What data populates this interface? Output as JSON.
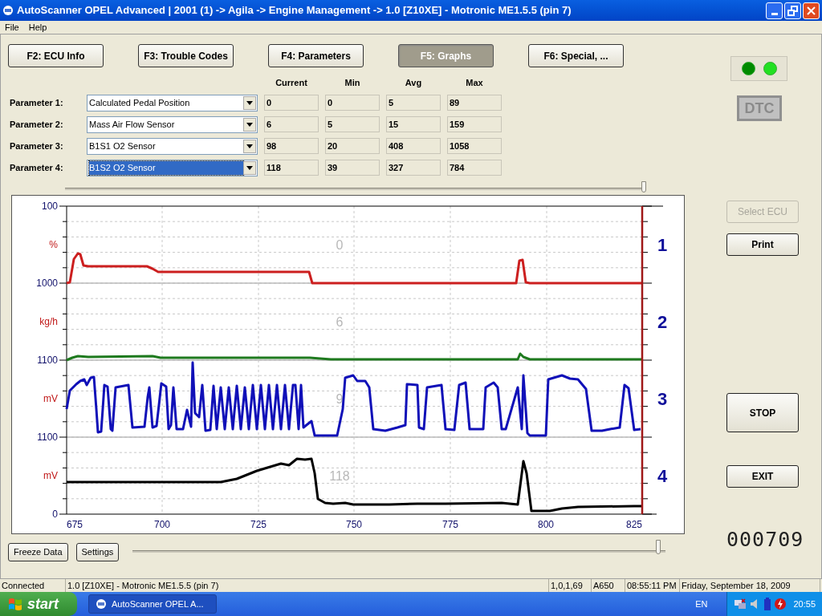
{
  "window": {
    "title": "AutoScanner OPEL Advanced  |  2001 (1) -> Agila -> Engine Management -> 1.0 [Z10XE] - Motronic ME1.5.5 (pin 7)"
  },
  "menu": [
    "File",
    "Help"
  ],
  "tabs": [
    {
      "label": "F2:  ECU Info",
      "selected": false
    },
    {
      "label": "F3:  Trouble Codes",
      "selected": false
    },
    {
      "label": "F4:  Parameters",
      "selected": false
    },
    {
      "label": "F5:  Graphs",
      "selected": true
    },
    {
      "label": "F6: Special, ...",
      "selected": false
    }
  ],
  "parameters": {
    "columns": [
      "Current",
      "Min",
      "Avg",
      "Max"
    ],
    "rows": [
      {
        "label": "Parameter 1:",
        "value": "Calculated Pedal Position",
        "selected": false,
        "cells": [
          "0",
          "0",
          "5",
          "89"
        ]
      },
      {
        "label": "Parameter 2:",
        "value": "Mass Air Flow Sensor",
        "selected": false,
        "cells": [
          "6",
          "5",
          "15",
          "159"
        ]
      },
      {
        "label": "Parameter 3:",
        "value": "B1S1 O2 Sensor",
        "selected": false,
        "cells": [
          "98",
          "20",
          "408",
          "1058"
        ]
      },
      {
        "label": "Parameter 4:",
        "value": "B1S2 O2 Sensor",
        "selected": true,
        "cells": [
          "118",
          "39",
          "327",
          "784"
        ]
      }
    ]
  },
  "zoom_slider": {
    "level": 1
  },
  "graph": {
    "y_labels": [
      {
        "kind": "number",
        "text": "100"
      },
      {
        "kind": "unit",
        "text": "%"
      },
      {
        "kind": "number",
        "text": "1000"
      },
      {
        "kind": "unit",
        "text": "kg/h"
      },
      {
        "kind": "number",
        "text": "1100"
      },
      {
        "kind": "unit",
        "text": "mV"
      },
      {
        "kind": "number",
        "text": "1100"
      },
      {
        "kind": "unit",
        "text": "mV"
      },
      {
        "kind": "number",
        "text": "0"
      }
    ],
    "bands": [
      {
        "number": "1",
        "overlay": "0",
        "color": "#cc1f1f"
      },
      {
        "number": "2",
        "overlay": "6",
        "color": "#1e7a1e"
      },
      {
        "number": "3",
        "overlay": "9",
        "color": "#1010b8"
      },
      {
        "number": "4",
        "overlay": "118",
        "color": "#000000"
      }
    ],
    "x_ticks": [
      "675",
      "700",
      "725",
      "750",
      "775",
      "800",
      "825"
    ]
  },
  "indicators": {
    "leds": [
      {
        "color": "#008a00"
      },
      {
        "color": "#22e022"
      }
    ],
    "dtc": {
      "label": "DTC",
      "active": false
    }
  },
  "side_buttons": [
    {
      "label": "Select ECU",
      "kind": "normal",
      "disabled": true
    },
    {
      "label": "Print",
      "kind": "normal",
      "disabled": false
    },
    {
      "label": "STOP",
      "kind": "large",
      "disabled": false
    },
    {
      "label": "EXIT",
      "kind": "normal",
      "disabled": false
    }
  ],
  "counter": "000709",
  "bottom_buttons": [
    "Freeze Data",
    "Settings"
  ],
  "time_slider": {
    "level": 0.99
  },
  "status_bar": [
    "Connected",
    "1.0 [Z10XE] - Motronic ME1.5.5 (pin 7)",
    "1,0,1,69",
    "A650",
    "08:55:11 PM",
    "Friday, September 18, 2009"
  ],
  "taskbar": {
    "start": "start",
    "tasks": [
      "AutoScanner OPEL A..."
    ],
    "language": "EN",
    "clock": "20:55"
  }
}
